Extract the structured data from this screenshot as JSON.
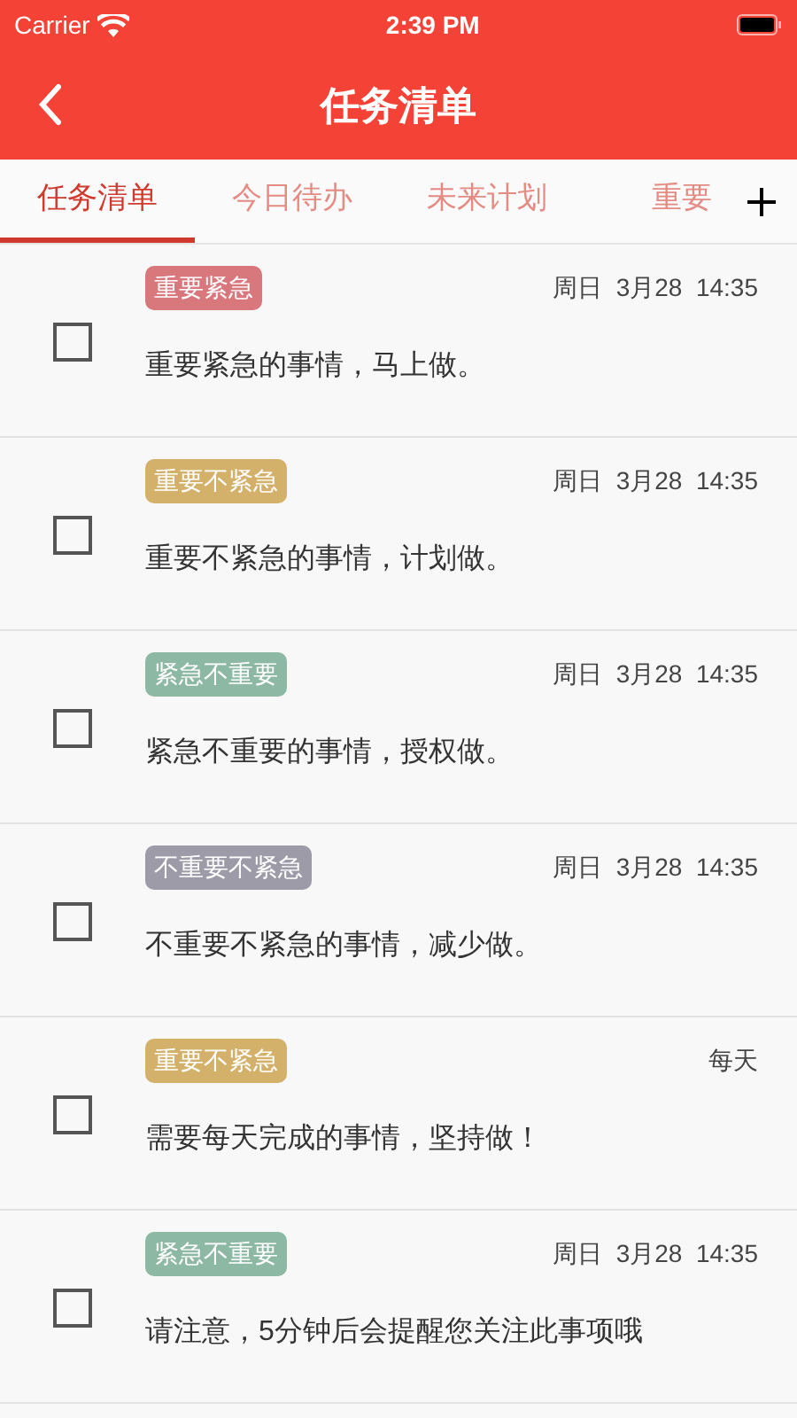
{
  "status_bar": {
    "carrier": "Carrier",
    "time": "2:39 PM"
  },
  "nav": {
    "title": "任务清单"
  },
  "tabs": [
    {
      "label": "任务清单",
      "selected": true
    },
    {
      "label": "今日待办",
      "selected": false
    },
    {
      "label": "未来计划",
      "selected": false
    },
    {
      "label": "重要",
      "selected": false
    }
  ],
  "tasks": [
    {
      "tag": "重要紧急",
      "color": "#d8777c",
      "date": "周日  3月28  14:35",
      "text": "重要紧急的事情，马上做。",
      "checked": false
    },
    {
      "tag": "重要不紧急",
      "color": "#d4b16a",
      "date": "周日  3月28  14:35",
      "text": "重要不紧急的事情，计划做。",
      "checked": false
    },
    {
      "tag": "紧急不重要",
      "color": "#8db8a4",
      "date": "周日  3月28  14:35",
      "text": "紧急不重要的事情，授权做。",
      "checked": false
    },
    {
      "tag": "不重要不紧急",
      "color": "#9d9ba8",
      "date": "周日  3月28  14:35",
      "text": "不重要不紧急的事情，减少做。",
      "checked": false
    },
    {
      "tag": "重要不紧急",
      "color": "#d4b16a",
      "date": "每天",
      "text": "需要每天完成的事情，坚持做！",
      "checked": false
    },
    {
      "tag": "紧急不重要",
      "color": "#8db8a4",
      "date": "周日  3月28  14:35",
      "text": "请注意，5分钟后会提醒您关注此事项哦",
      "checked": false
    }
  ]
}
